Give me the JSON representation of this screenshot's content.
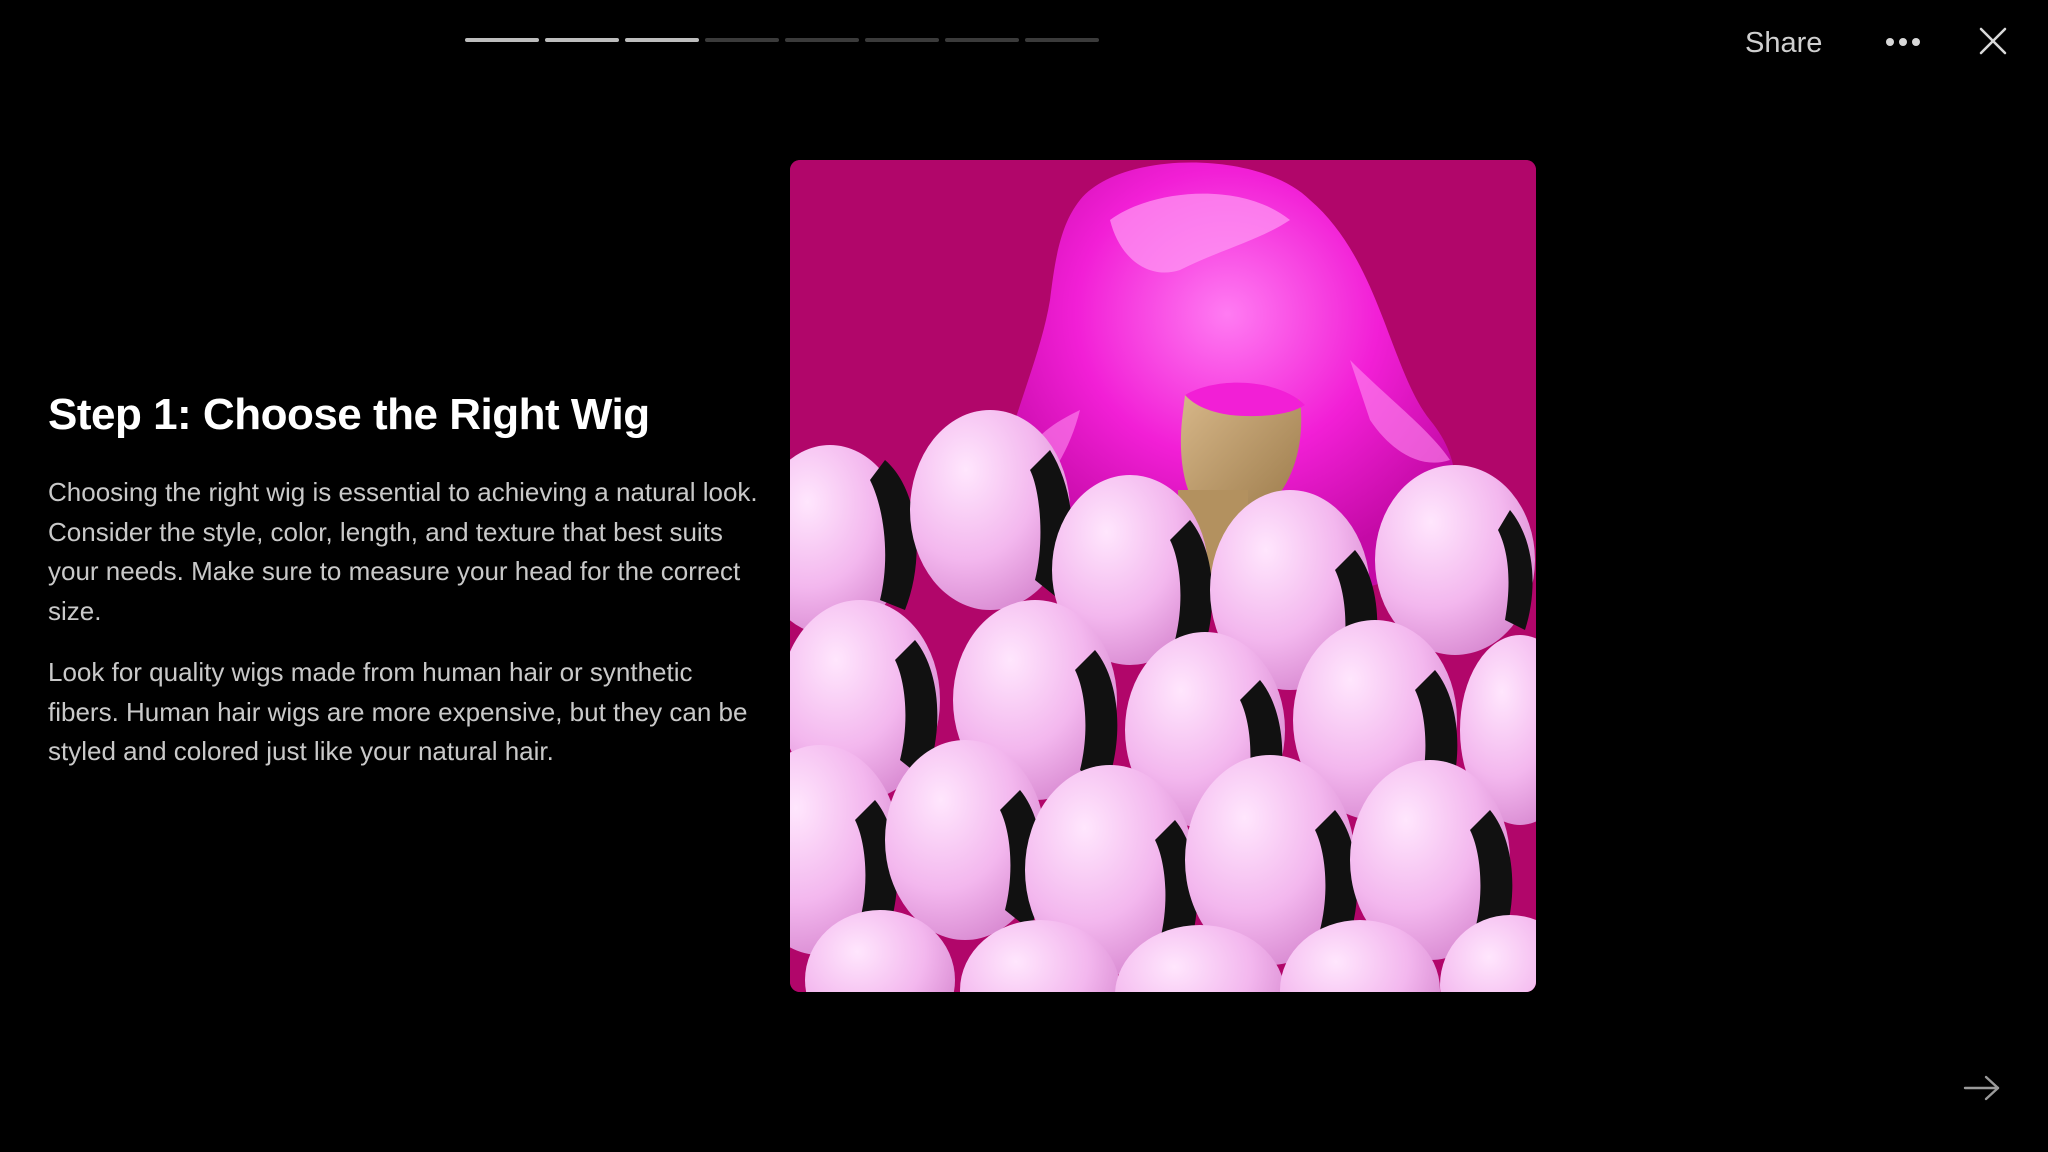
{
  "progress": {
    "total_steps": 8,
    "completed_steps": 3
  },
  "header": {
    "share_label": "Share",
    "more_icon": "more-dots-icon",
    "close_icon": "close-icon"
  },
  "step": {
    "title": "Step 1: Choose the Right Wig",
    "paragraphs": [
      "Choosing the right wig is essential to achieving a natural look. Consider the style, color, length, and texture that best suits your needs. Make sure to measure your head for the correct size.",
      "Look for quality wigs made from human hair or synthetic fibers. Human hair wigs are more expensive, but they can be styled and colored just like your natural hair."
    ]
  },
  "footer": {
    "next_icon": "arrow-right-icon"
  },
  "colors": {
    "background": "#000000",
    "media_background": "#b1066a",
    "wig_magenta": "#f21fd6",
    "mannequin_pink": "#f2b6ee",
    "progress_done": "#bdbdbd",
    "progress_pending": "#3b3b3b"
  }
}
